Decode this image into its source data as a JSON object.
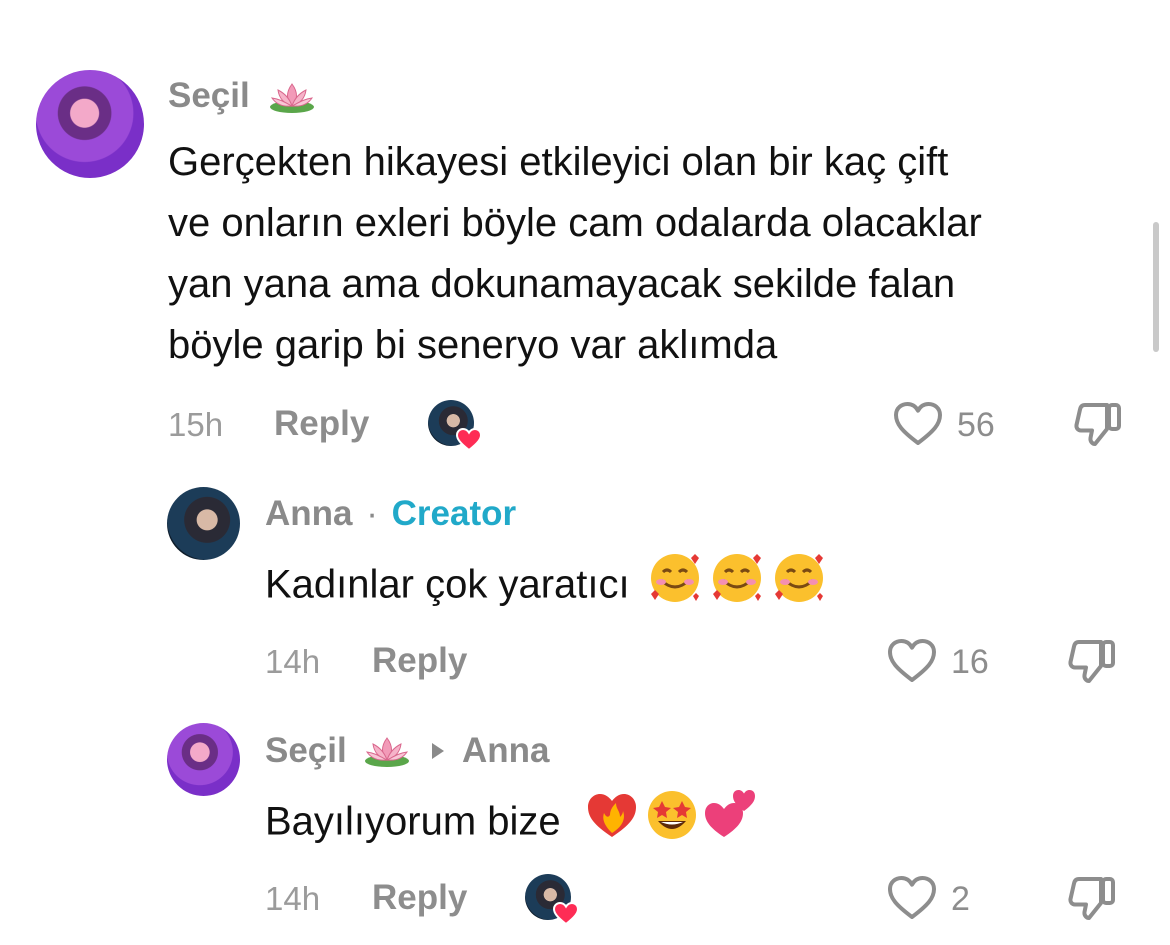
{
  "comments": [
    {
      "author": "Seçil",
      "text_lines": [
        "Gerçekten hikayesi etkileyici olan bir kaç çift",
        "ve onların exleri böyle cam odalarda olacaklar",
        "yan yana ama dokunamayacak sekilde falan",
        "böyle garip bi seneryo var aklımda"
      ],
      "time": "15h",
      "reply_label": "Reply",
      "likes": "56"
    },
    {
      "author": "Anna",
      "separator": "·",
      "badge": "Creator",
      "text": "Kadınlar çok yaratıcı",
      "time": "14h",
      "reply_label": "Reply",
      "likes": "16"
    },
    {
      "author": "Seçil",
      "reply_to": "Anna",
      "text": "Bayılıyorum bize",
      "time": "14h",
      "reply_label": "Reply",
      "likes": "2"
    }
  ],
  "icons": {
    "author_decoration": "lotus-emoji",
    "like": "heart-outline-icon",
    "dislike": "thumbs-down-icon",
    "creator_liked": "heart-badge-icon",
    "reply_arrow": "triangle-right-icon"
  },
  "colors": {
    "creator_badge": "#21a9c9",
    "liked_heart": "#fe2c55",
    "meta_gray": "#8d8d8d"
  }
}
